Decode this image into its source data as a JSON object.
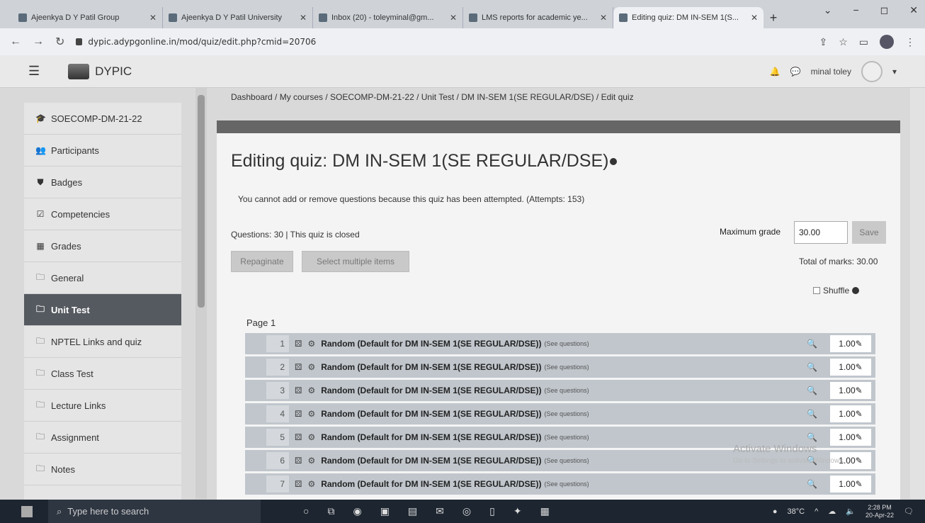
{
  "browser": {
    "tabs": [
      {
        "label": "Ajeenkya D Y Patil Group",
        "active": false
      },
      {
        "label": "Ajeenkya D Y Patil University",
        "active": false
      },
      {
        "label": "Inbox (20) - toleyminal@gm...",
        "active": false
      },
      {
        "label": "LMS reports for academic ye...",
        "active": false
      },
      {
        "label": "Editing quiz: DM IN-SEM 1(S...",
        "active": true
      }
    ],
    "url": "dypic.adypgonline.in/mod/quiz/edit.php?cmid=20706"
  },
  "navbar": {
    "brand": "DYPIC",
    "user_name": "minal toley"
  },
  "sidebar": {
    "items": [
      {
        "label": "SOECOMP-DM-21-22",
        "icon": "graduation-cap-icon",
        "glyph": "🎓",
        "active": false
      },
      {
        "label": "Participants",
        "icon": "users-icon",
        "glyph": "👥",
        "active": false
      },
      {
        "label": "Badges",
        "icon": "shield-icon",
        "glyph": "⛊",
        "active": false
      },
      {
        "label": "Competencies",
        "icon": "check-square-icon",
        "glyph": "☑",
        "active": false
      },
      {
        "label": "Grades",
        "icon": "table-icon",
        "glyph": "▦",
        "active": false
      },
      {
        "label": "General",
        "icon": "folder-icon",
        "glyph": "🗀",
        "active": false
      },
      {
        "label": "Unit Test",
        "icon": "folder-icon",
        "glyph": "🗀",
        "active": true
      },
      {
        "label": "NPTEL Links and quiz",
        "icon": "folder-icon",
        "glyph": "🗀",
        "active": false
      },
      {
        "label": "Class Test",
        "icon": "folder-icon",
        "glyph": "🗀",
        "active": false
      },
      {
        "label": "Lecture Links",
        "icon": "folder-icon",
        "glyph": "🗀",
        "active": false
      },
      {
        "label": "Assignment",
        "icon": "folder-icon",
        "glyph": "🗀",
        "active": false
      },
      {
        "label": "Notes",
        "icon": "folder-icon",
        "glyph": "🗀",
        "active": false
      }
    ]
  },
  "breadcrumb": "Dashboard / My courses / SOECOMP-DM-21-22 / Unit Test / DM IN-SEM 1(SE REGULAR/DSE) / Edit quiz",
  "main": {
    "title": "Editing quiz: DM IN-SEM 1(SE REGULAR/DSE)",
    "notice": "You cannot add or remove questions because this quiz has been attempted. (Attempts: 153)",
    "questions_info": "Questions: 30 | This quiz is closed",
    "repaginate_label": "Repaginate",
    "select_multiple_label": "Select multiple items",
    "max_grade_label": "Maximum grade",
    "max_grade_value": "30.00",
    "save_label": "Save",
    "total_marks": "Total of marks: 30.00",
    "shuffle_label": "Shuffle",
    "page_label": "Page 1",
    "slots": [
      {
        "num": "1",
        "name": "Random (Default for DM IN-SEM 1(SE REGULAR/DSE))",
        "see": "(See questions)",
        "mark": "1.00"
      },
      {
        "num": "2",
        "name": "Random (Default for DM IN-SEM 1(SE REGULAR/DSE))",
        "see": "(See questions)",
        "mark": "1.00"
      },
      {
        "num": "3",
        "name": "Random (Default for DM IN-SEM 1(SE REGULAR/DSE))",
        "see": "(See questions)",
        "mark": "1.00"
      },
      {
        "num": "4",
        "name": "Random (Default for DM IN-SEM 1(SE REGULAR/DSE))",
        "see": "(See questions)",
        "mark": "1.00"
      },
      {
        "num": "5",
        "name": "Random (Default for DM IN-SEM 1(SE REGULAR/DSE))",
        "see": "(See questions)",
        "mark": "1.00"
      },
      {
        "num": "6",
        "name": "Random (Default for DM IN-SEM 1(SE REGULAR/DSE))",
        "see": "(See questions)",
        "mark": "1.00"
      },
      {
        "num": "7",
        "name": "Random (Default for DM IN-SEM 1(SE REGULAR/DSE))",
        "see": "(See questions)",
        "mark": "1.00"
      }
    ]
  },
  "watermark": {
    "line1": "Activate Windows",
    "line2": "Go to Settings to activate Windows."
  },
  "taskbar": {
    "search_placeholder": "Type here to search",
    "temperature": "38°C",
    "time": "2:28 PM",
    "date": "20-Apr-22"
  }
}
